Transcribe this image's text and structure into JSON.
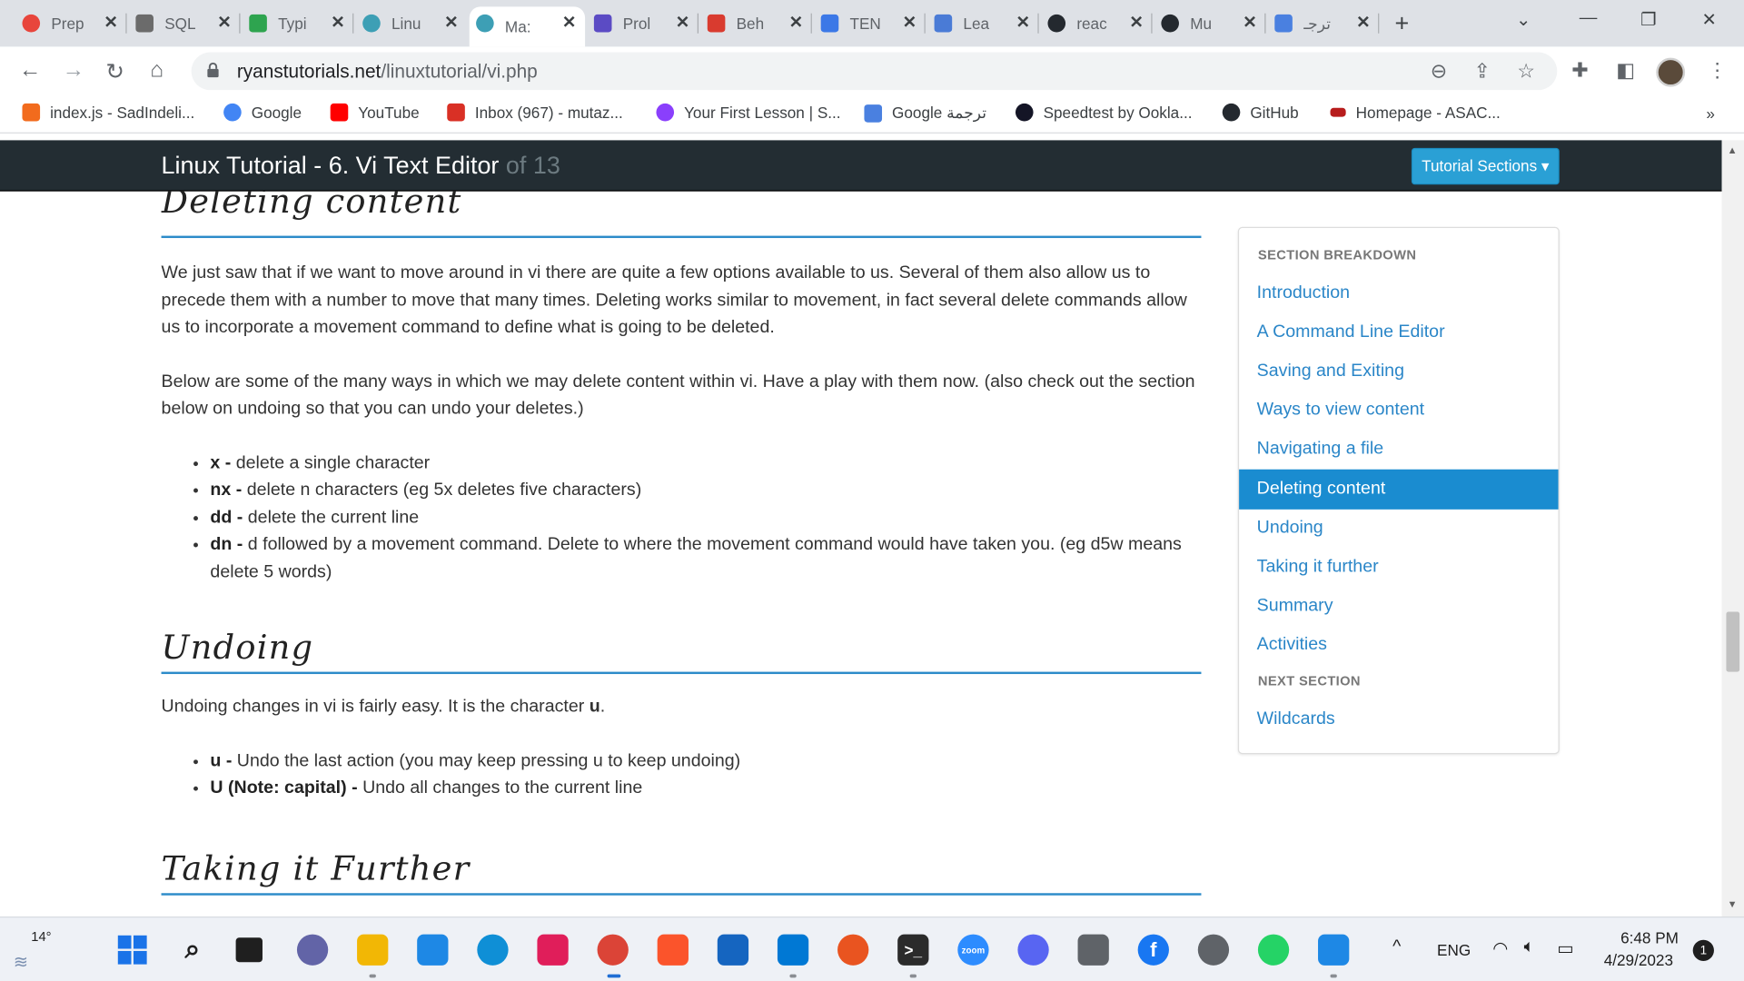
{
  "browser": {
    "tabs": [
      {
        "label": "Prep",
        "color": "#e8453c"
      },
      {
        "label": "SQL",
        "color": "#6b6b6b"
      },
      {
        "label": "Typi",
        "color": "#2ea44f"
      },
      {
        "label": "Linu",
        "color": "#3d9fb5"
      },
      {
        "label": "Ma:",
        "color": "#3d9fb5"
      },
      {
        "label": "Prol",
        "color": "#5b4bc4"
      },
      {
        "label": "Beh",
        "color": "#d93b2f"
      },
      {
        "label": "TEN",
        "color": "#3b78e7"
      },
      {
        "label": "Lea",
        "color": "#4a7bd6"
      },
      {
        "label": "reac",
        "color": "#24292f"
      },
      {
        "label": "Mu",
        "color": "#24292f"
      },
      {
        "label": "ترجـ",
        "color": "#4a80e0"
      }
    ],
    "new_tab": "+",
    "url_host": "ryanstutorials.net",
    "url_path": "/linuxtutorial/vi.php",
    "bookmarks": [
      {
        "label": "index.js - SadIndeli...",
        "color": "#f26b1d"
      },
      {
        "label": "Google",
        "color": "#4285f4"
      },
      {
        "label": "YouTube",
        "color": "#ff0000"
      },
      {
        "label": "Inbox (967) - mutaz...",
        "color": "#d93025"
      },
      {
        "label": "Your First Lesson | S...",
        "color": "#8a3ffc"
      },
      {
        "label": "Google ترجمة",
        "color": "#4a80e0"
      },
      {
        "label": "Speedtest by Ookla...",
        "color": "#141526"
      },
      {
        "label": "GitHub",
        "color": "#24292f"
      },
      {
        "label": "Homepage - ASAC...",
        "color": "#b71c1c"
      }
    ],
    "bookmarks_more": "»"
  },
  "site": {
    "title": "Linux Tutorial - 6. Vi Text Editor",
    "title_of": "of 13",
    "sections_button": "Tutorial Sections ▾"
  },
  "article": {
    "deleting_heading": "Deleting content",
    "deleting_p1": "We just saw that if we want to move around in vi there are quite a few options available to us. Several of them also allow us to precede them with a number to move that many times. Deleting works similar to movement, in fact several delete commands allow us to incorporate a movement command to define what is going to be deleted.",
    "deleting_p2": "Below are some of the many ways in which we may delete content within vi. Have a play with them now. (also check out the section below on undoing so that you can undo your deletes.)",
    "delete_cmds": [
      {
        "key": "x -",
        "desc": " delete a single character"
      },
      {
        "key": "nx -",
        "desc": " delete n characters (eg 5x deletes five characters)"
      },
      {
        "key": "dd -",
        "desc": " delete the current line"
      },
      {
        "key": "dn -",
        "desc": " d followed by a movement command. Delete to where the movement command would have taken you. (eg d5w means delete 5 words)"
      }
    ],
    "undoing_heading": "Undoing",
    "undoing_p1": "Undoing changes in vi is fairly easy. It is the character ",
    "undoing_char": "u",
    "undoing_p1_end": ".",
    "undo_cmds": [
      {
        "key": "u -",
        "desc": " Undo the last action (you may keep pressing u to keep undoing)"
      },
      {
        "key": "U (Note: capital) -",
        "desc": " Undo all changes to the current line"
      }
    ],
    "further_heading": "Taking it Further"
  },
  "sidebar": {
    "section_heading": "SECTION BREAKDOWN",
    "items": [
      "Introduction",
      "A Command Line Editor",
      "Saving and Exiting",
      "Ways to view content",
      "Navigating a file",
      "Deleting content",
      "Undoing",
      "Taking it further",
      "Summary",
      "Activities"
    ],
    "active_item": "Deleting content",
    "next_heading": "NEXT SECTION",
    "next_item": "Wildcards"
  },
  "taskbar": {
    "weather": "14°",
    "lang": "ENG",
    "time": "6:48 PM",
    "date": "4/29/2023",
    "notifications": "1",
    "apps": [
      {
        "name": "start",
        "color": "#1a73e8"
      },
      {
        "name": "search",
        "color": "#1f1f1f"
      },
      {
        "name": "task-view",
        "color": "#1f1f1f"
      },
      {
        "name": "chat",
        "color": "#6264a7"
      },
      {
        "name": "file-explorer",
        "color": "#f2b705"
      },
      {
        "name": "store",
        "color": "#1e88e5"
      },
      {
        "name": "edge",
        "color": "#0f8fd6"
      },
      {
        "name": "slack",
        "color": "#e01e5a"
      },
      {
        "name": "chrome",
        "color": "#db4437"
      },
      {
        "name": "brave",
        "color": "#fb542b"
      },
      {
        "name": "mail",
        "color": "#1565c0"
      },
      {
        "name": "vscode",
        "color": "#0078d4"
      },
      {
        "name": "ubuntu",
        "color": "#e95420"
      },
      {
        "name": "terminal",
        "color": "#2b2b2b"
      },
      {
        "name": "zoom",
        "color": "#2d8cff"
      },
      {
        "name": "discord",
        "color": "#5865f2"
      },
      {
        "name": "camera",
        "color": "#5f6368"
      },
      {
        "name": "facebook",
        "color": "#1877f2"
      },
      {
        "name": "settings",
        "color": "#5f6368"
      },
      {
        "name": "whatsapp",
        "color": "#25d366"
      },
      {
        "name": "photos",
        "color": "#1e88e5"
      }
    ]
  }
}
